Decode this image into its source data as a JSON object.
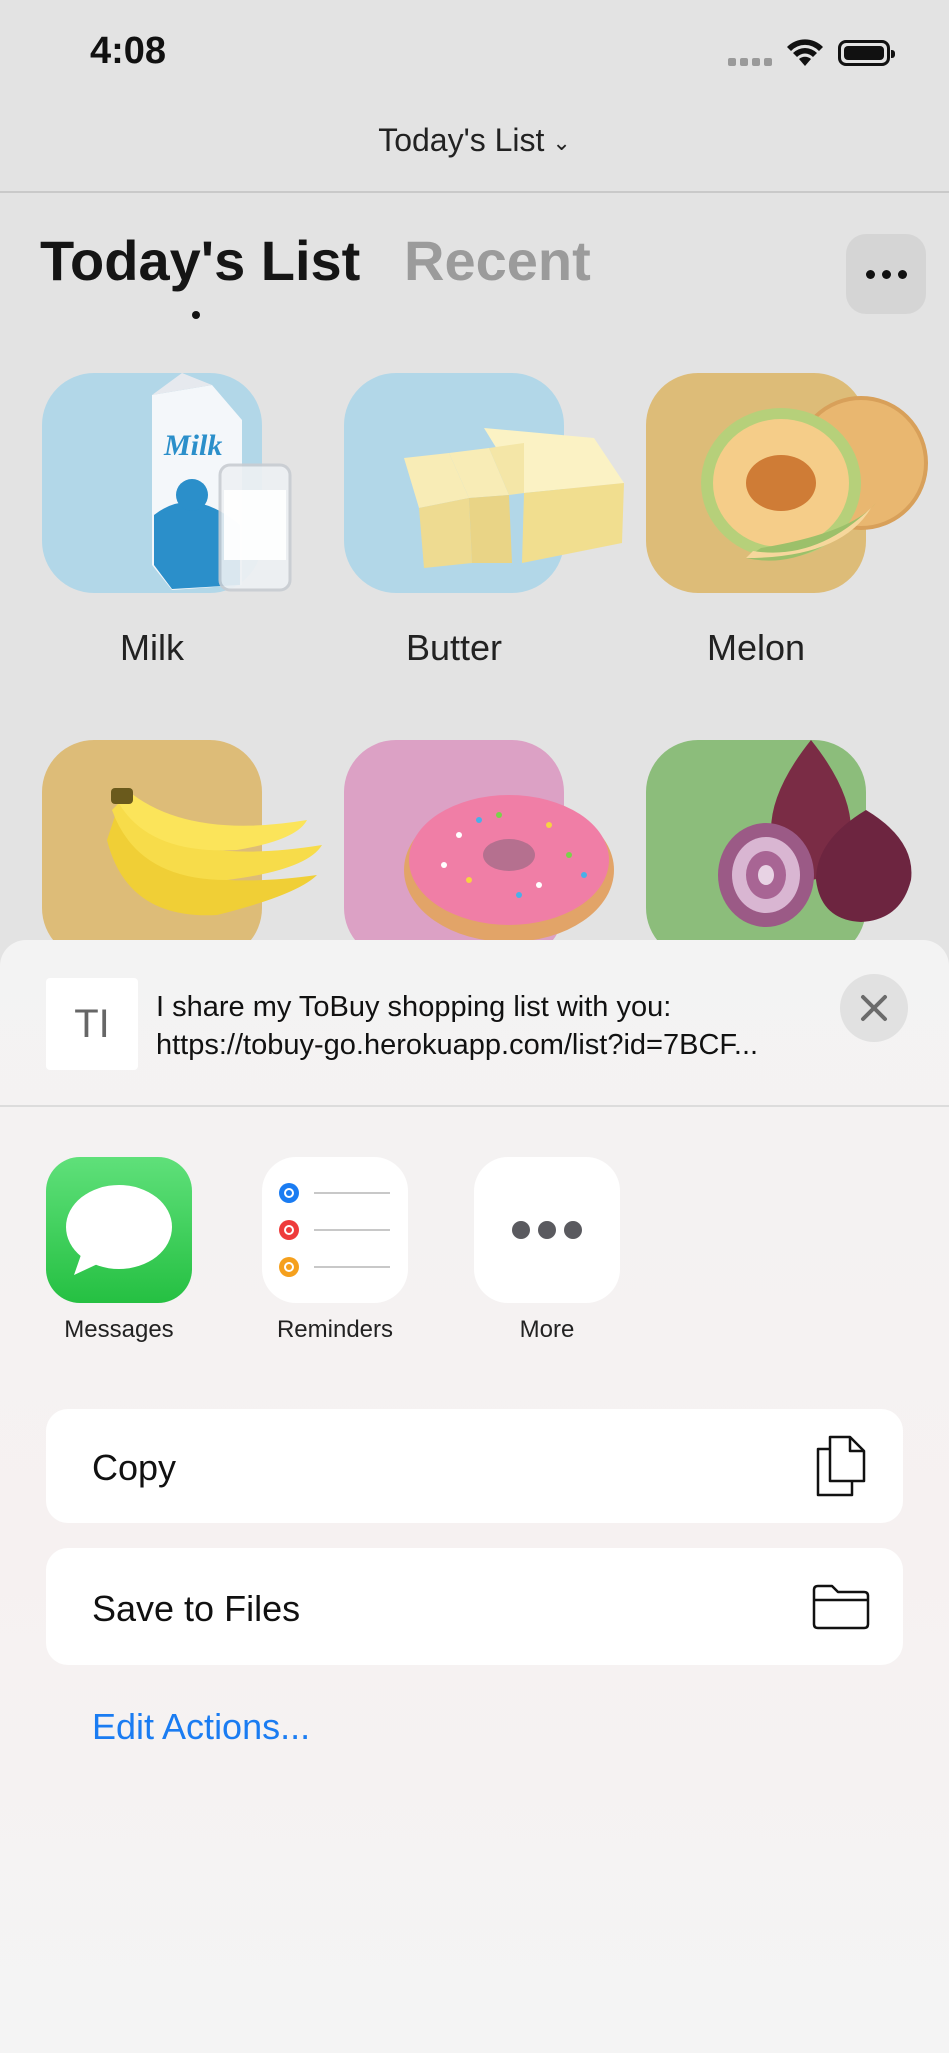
{
  "status_bar": {
    "time": "4:08"
  },
  "nav": {
    "title": "Today's List",
    "chevron": "⌄"
  },
  "tabs": {
    "active": "Today's List",
    "recent": "Recent"
  },
  "items": [
    {
      "name": "Milk",
      "tile_color": "#b2d7e8"
    },
    {
      "name": "Butter",
      "tile_color": "#b2d7e8"
    },
    {
      "name": "Melon",
      "tile_color": "#ddbc78"
    },
    {
      "name": "Banana",
      "tile_color": "#ddbc78"
    },
    {
      "name": "Donut",
      "tile_color": "#dca1c5"
    },
    {
      "name": "Onion",
      "tile_color": "#8cbd7b"
    }
  ],
  "share": {
    "preview_icon": "TI",
    "line1": "I share my ToBuy shopping list with you:",
    "line2": "https://tobuy-go.herokuapp.com/list?id=7BCF..."
  },
  "apps": [
    {
      "label": "Messages",
      "icon": "messages-icon"
    },
    {
      "label": "Reminders",
      "icon": "reminders-icon"
    },
    {
      "label": "More",
      "icon": "more-icon"
    }
  ],
  "actions": [
    {
      "label": "Copy",
      "icon": "copy-icon"
    },
    {
      "label": "Save to Files",
      "icon": "folder-icon"
    }
  ],
  "edit_actions": "Edit Actions...",
  "colors": {
    "accent": "#1a7cf2",
    "messages_green": "#34c759"
  }
}
